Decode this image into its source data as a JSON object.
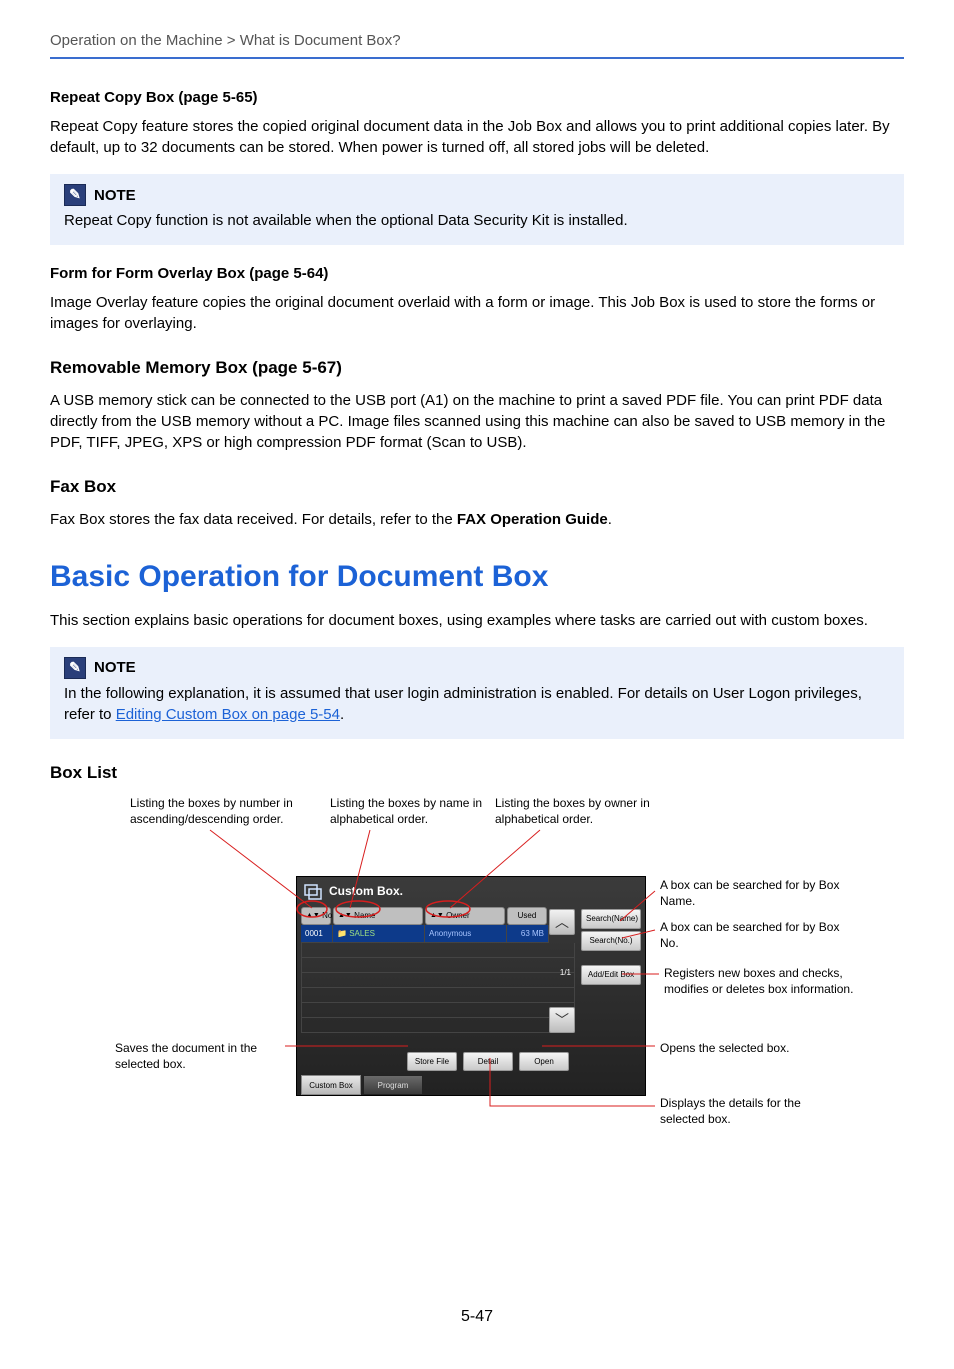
{
  "breadcrumb": "Operation on the Machine > What is Document Box?",
  "sec1": {
    "h": "Repeat Copy Box (page 5-65)",
    "p": "Repeat Copy feature stores the copied original document data in the Job Box and allows you to print additional copies later. By default, up to 32 documents can be stored. When power is turned off, all stored jobs will be deleted."
  },
  "note1": {
    "label": "NOTE",
    "body": "Repeat Copy function is not available when the optional Data Security Kit is installed."
  },
  "sec2": {
    "h": "Form for Form Overlay Box (page 5-64)",
    "p": "Image Overlay feature copies the original document overlaid with a form or image. This Job Box is used to store the forms or images for overlaying."
  },
  "sec3": {
    "h": "Removable Memory Box (page 5-67)",
    "p": "A USB memory stick can be connected to the USB port (A1) on the machine to print a saved PDF file. You can print PDF data directly from the USB memory without a PC. Image files scanned using this machine can also be saved to USB memory in the PDF, TIFF, JPEG, XPS or high compression PDF format (Scan to USB)."
  },
  "sec4": {
    "h": "Fax Box",
    "p_pre": "Fax Box stores the fax data received. For details, refer to the ",
    "p_bold": "FAX Operation Guide",
    "p_post": "."
  },
  "h1": "Basic Operation for Document Box",
  "h1_intro": "This section explains basic operations for document boxes, using examples where tasks are carried out with custom boxes.",
  "note2": {
    "label": "NOTE",
    "pre": "In the following explanation, it is assumed that user login administration is enabled. For details on User Logon privileges, refer to ",
    "link": "Editing Custom Box on page 5-54",
    "post": "."
  },
  "boxlist_h": "Box List",
  "callouts": {
    "top1": "Listing the boxes by number in ascending/descending order.",
    "top2": "Listing the boxes by name in alphabetical order.",
    "top3": "Listing the boxes by owner in alphabetical order.",
    "left1": "Saves the document in the selected box.",
    "r1": "A box can be searched for by Box Name.",
    "r2": "A box can be searched for by Box No.",
    "r3": "Registers new boxes and checks, modifies or deletes box information.",
    "r4": "Opens the selected box.",
    "r5": "Displays the details for the selected box."
  },
  "panel": {
    "title": "Custom Box.",
    "headers": {
      "no": "No.",
      "name": "Name",
      "owner": "Owner",
      "used": "Used"
    },
    "row": {
      "no": "0001",
      "name": "SALES",
      "owner": "Anonymous",
      "used": "63 MB"
    },
    "side": {
      "searchName": "Search(Name)",
      "searchNo": "Search(No.)",
      "addEdit": "Add/Edit Box"
    },
    "page": "1/1",
    "footer": {
      "store": "Store File",
      "detail": "Detail",
      "open": "Open"
    },
    "tabs": {
      "custom": "Custom Box",
      "program": "Program"
    }
  },
  "page_number": "5-47"
}
